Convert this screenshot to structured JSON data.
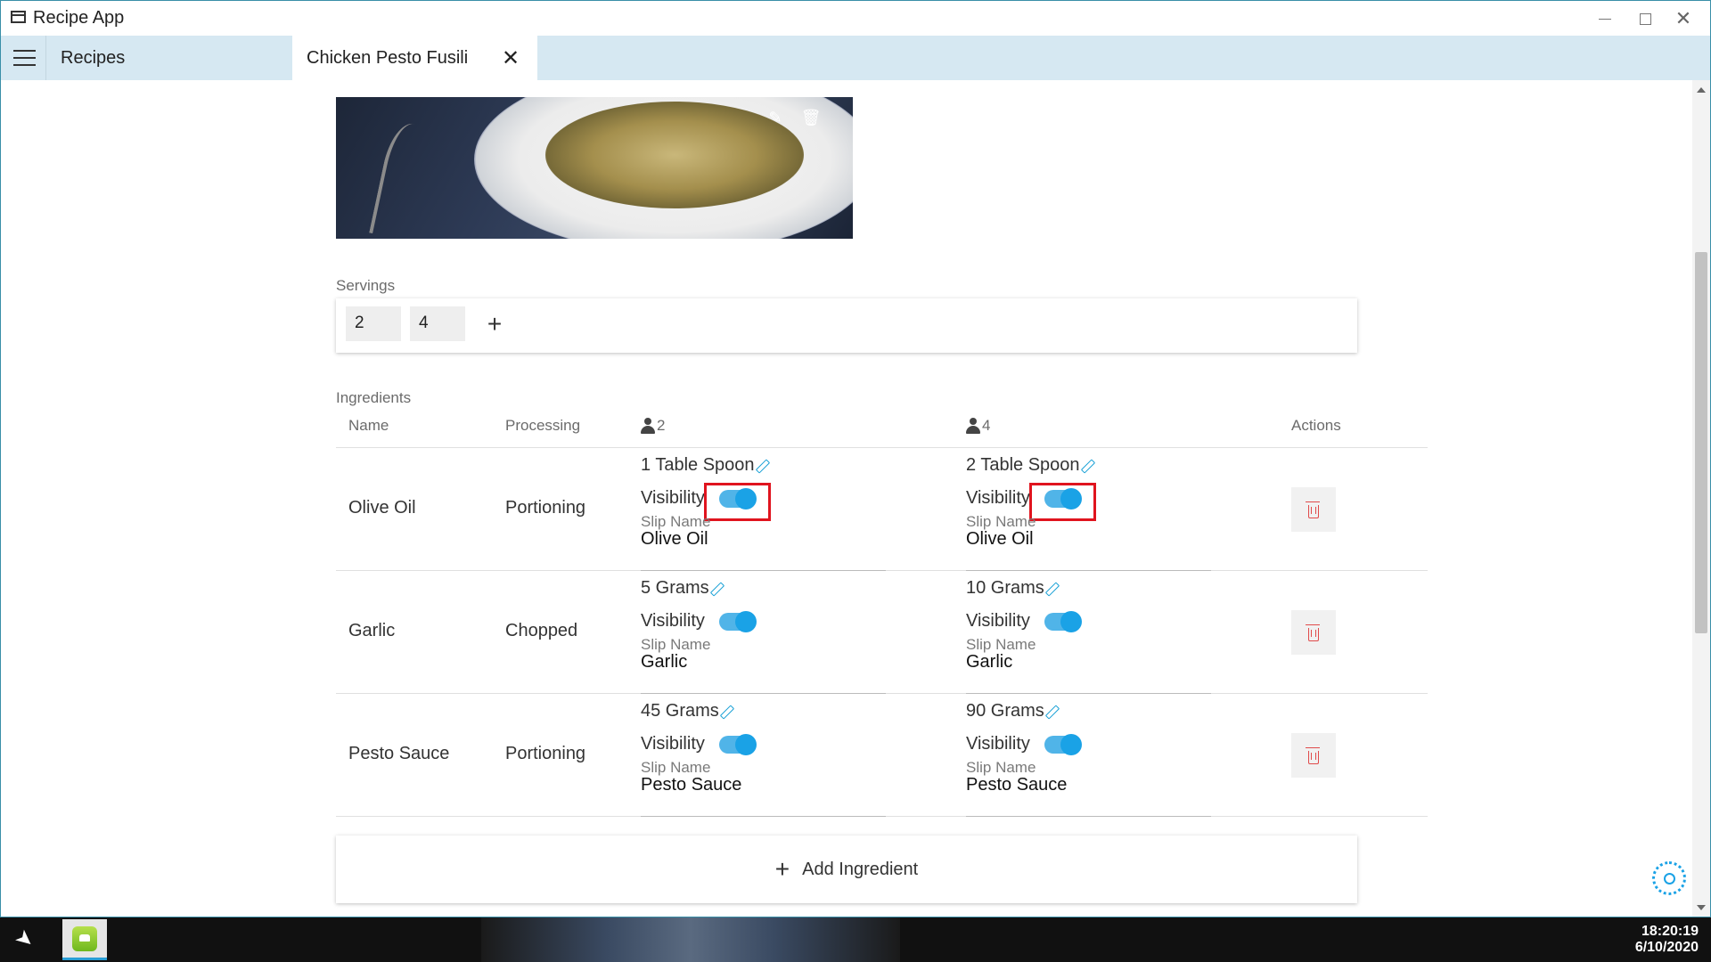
{
  "window": {
    "title": "Recipe App"
  },
  "tabs": [
    {
      "label": "Recipes"
    },
    {
      "label": "Chicken Pesto Fusili"
    }
  ],
  "servings": {
    "label": "Servings",
    "values": [
      "2",
      "4"
    ]
  },
  "ingredients": {
    "label": "Ingredients",
    "headers": {
      "name": "Name",
      "processing": "Processing",
      "serving_1": "2",
      "serving_2": "4",
      "actions": "Actions"
    },
    "visibility_label": "Visibility",
    "slip_name_label": "Slip Name",
    "rows": [
      {
        "name": "Olive Oil",
        "processing": "Portioning",
        "s1_amount": "1 Table Spoon",
        "s2_amount": "2 Table Spoon",
        "s1_slip": "Olive Oil",
        "s2_slip": "Olive Oil",
        "s1_visible": true,
        "s2_visible": true
      },
      {
        "name": "Garlic",
        "processing": "Chopped",
        "s1_amount": "5 Grams",
        "s2_amount": "10 Grams",
        "s1_slip": "Garlic",
        "s2_slip": "Garlic",
        "s1_visible": true,
        "s2_visible": true
      },
      {
        "name": "Pesto Sauce",
        "processing": "Portioning",
        "s1_amount": "45 Grams",
        "s2_amount": "90 Grams",
        "s1_slip": "Pesto Sauce",
        "s2_slip": "Pesto Sauce",
        "s1_visible": true,
        "s2_visible": true
      }
    ],
    "add_label": "Add Ingredient"
  },
  "taskbar": {
    "time": "18:20:19",
    "date": "6/10/2020"
  },
  "colors": {
    "accent": "#1aa2e6",
    "tab_bar": "#d6e8f2",
    "highlight": "#e0141e",
    "delete": "#e04b4b"
  }
}
